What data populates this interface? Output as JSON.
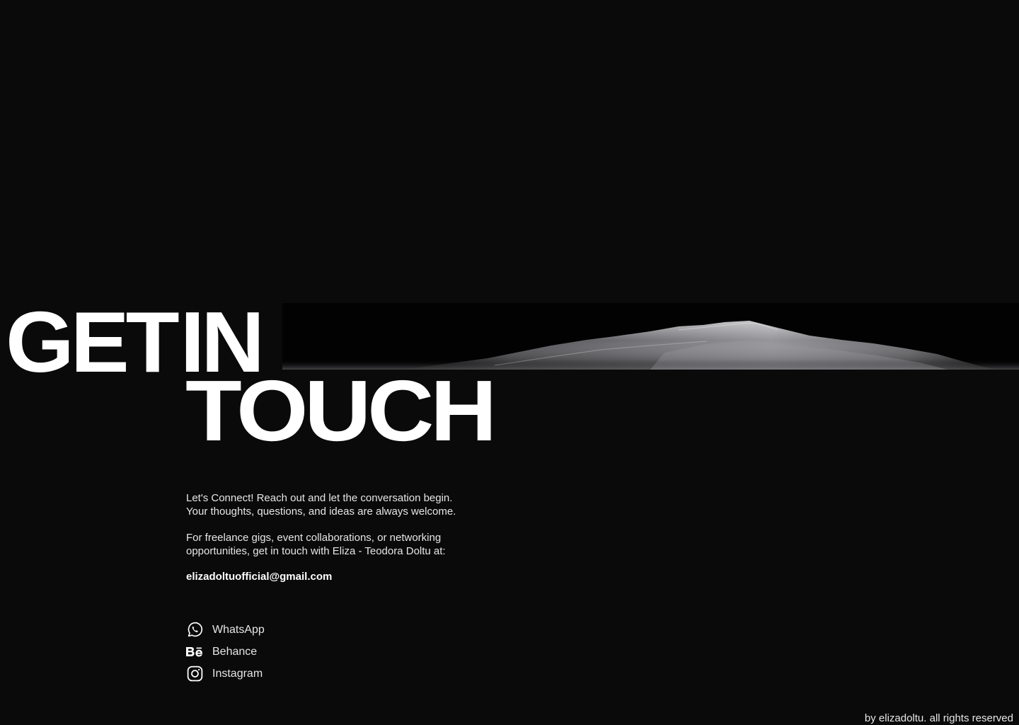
{
  "colors": {
    "background": "#0a0a0a",
    "banner": "#020203",
    "text": "#ffffff",
    "muted_text": "#e6e6e6"
  },
  "headline": {
    "line1_word1": "GET",
    "line1_word2": "IN",
    "line2": "TOUCH"
  },
  "intro": {
    "paragraph1_line1": "Let's Connect! Reach out and let the conversation begin.",
    "paragraph1_line2": "Your thoughts, questions, and ideas are always welcome.",
    "paragraph2_line1": "For freelance gigs, event collaborations, or networking",
    "paragraph2_line2": "opportunities, get in touch with Eliza - Teodora Doltu at:"
  },
  "email": "elizadoltuofficial@gmail.com",
  "social": [
    {
      "label": "WhatsApp",
      "icon": "whatsapp-icon"
    },
    {
      "label": "Behance",
      "icon": "behance-icon"
    },
    {
      "label": "Instagram",
      "icon": "instagram-icon"
    }
  ],
  "footer": {
    "text": "by elizadoltu. all rights reserved"
  }
}
